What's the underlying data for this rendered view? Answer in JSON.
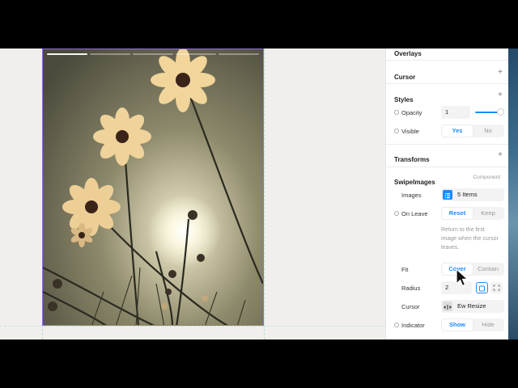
{
  "panel": {
    "overlays_label": "Overlays",
    "cursor_label": "Cursor",
    "styles_label": "Styles",
    "opacity": {
      "label": "Opacity",
      "value": "1",
      "level": 0.95
    },
    "visible": {
      "label": "Visible",
      "options": [
        "Yes",
        "No"
      ],
      "selected": "Yes"
    },
    "transforms_label": "Transforms",
    "swipe": {
      "title": "SwipeImages",
      "tag": "Component",
      "images": {
        "label": "Images",
        "value": "5 Items"
      },
      "on_leave": {
        "label": "On Leave",
        "options": [
          "Reset",
          "Keep"
        ],
        "selected": "Reset",
        "hint": [
          "Return to the first",
          "image when the cursor",
          "leaves."
        ]
      },
      "fit": {
        "label": "Fit",
        "options": [
          "Cover",
          "Contain"
        ],
        "selected": "Cover"
      },
      "radius": {
        "label": "Radius",
        "value": "2"
      },
      "cursor": {
        "label": "Cursor",
        "value": "Ew Resize"
      },
      "indicator": {
        "label": "Indicator",
        "options": [
          "Show",
          "Hide"
        ],
        "selected": "Show"
      }
    },
    "plus": "+",
    "colors": {
      "accent": "#1a8cff",
      "selection": "#8b6fd0"
    },
    "icons": [
      "plus-icon",
      "list-icon",
      "ew-resize-icon",
      "corner-radius-icon",
      "expand-corners-icon",
      "pointer-cursor-icon"
    ]
  },
  "canvas": {
    "image_count": 5,
    "active_index": 0
  }
}
